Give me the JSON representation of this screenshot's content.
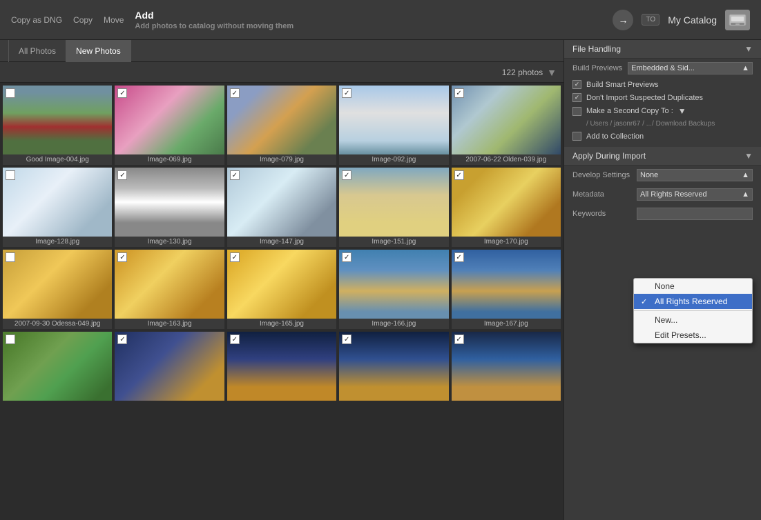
{
  "topbar": {
    "actions": [
      {
        "label": "Copy as DNG",
        "active": false
      },
      {
        "label": "Copy",
        "active": false
      },
      {
        "label": "Move",
        "active": false
      },
      {
        "label": "Add",
        "active": true
      }
    ],
    "subtitle": "Add photos to catalog without moving them",
    "arrow_symbol": "→",
    "to_badge": "TO",
    "catalog_name": "My Catalog",
    "drive_icon": "🖥"
  },
  "tabs": [
    {
      "label": "All Photos",
      "active": false
    },
    {
      "label": "New Photos",
      "active": true
    }
  ],
  "filter": {
    "photo_count": "122 photos",
    "filter_icon": "▼"
  },
  "photos": [
    {
      "id": "p1",
      "filename": "Good Image-004.jpg",
      "checked": false,
      "css_class": "img-red-barn"
    },
    {
      "id": "p2",
      "filename": "Image-069.jpg",
      "checked": true,
      "css_class": "img-tulips"
    },
    {
      "id": "p3",
      "filename": "Image-079.jpg",
      "checked": true,
      "css_class": "img-church"
    },
    {
      "id": "p4",
      "filename": "Image-092.jpg",
      "checked": true,
      "css_class": "img-cruise"
    },
    {
      "id": "p5",
      "filename": "2007-06-22 Olden-039.jpg",
      "checked": true,
      "css_class": "img-house"
    },
    {
      "id": "p6",
      "filename": "Image-128.jpg",
      "checked": false,
      "css_class": "img-ice1"
    },
    {
      "id": "p7",
      "filename": "Image-130.jpg",
      "checked": true,
      "css_class": "img-bw-wave"
    },
    {
      "id": "p8",
      "filename": "Image-147.jpg",
      "checked": true,
      "css_class": "img-ice2"
    },
    {
      "id": "p9",
      "filename": "Image-151.jpg",
      "checked": true,
      "css_class": "img-sand"
    },
    {
      "id": "p10",
      "filename": "Image-170.jpg",
      "checked": true,
      "css_class": "img-palace1"
    },
    {
      "id": "p11",
      "filename": "2007-09-30 Odessa-049.jpg",
      "checked": false,
      "css_class": "img-odessa"
    },
    {
      "id": "p12",
      "filename": "Image-163.jpg",
      "checked": true,
      "css_class": "img-opera"
    },
    {
      "id": "p13",
      "filename": "Image-165.jpg",
      "checked": true,
      "css_class": "img-palace2"
    },
    {
      "id": "p14",
      "filename": "Image-166.jpg",
      "checked": true,
      "css_class": "img-statue1"
    },
    {
      "id": "p15",
      "filename": "Image-167.jpg",
      "checked": true,
      "css_class": "img-statue2"
    },
    {
      "id": "p16",
      "filename": "",
      "checked": false,
      "css_class": "img-tram"
    },
    {
      "id": "p17",
      "filename": "",
      "checked": true,
      "css_class": "img-night1"
    },
    {
      "id": "p18",
      "filename": "",
      "checked": true,
      "css_class": "img-night2"
    },
    {
      "id": "p19",
      "filename": "",
      "checked": true,
      "css_class": "img-night3"
    },
    {
      "id": "p20",
      "filename": "",
      "checked": true,
      "css_class": "img-night4"
    }
  ],
  "right_panel": {
    "file_handling": {
      "header": "File Handling",
      "build_previews_label": "Build Previews",
      "build_previews_value": "Embedded & Sid...",
      "build_smart_previews_label": "Build Smart Previews",
      "build_smart_previews_checked": true,
      "dont_import_dupes_label": "Don't Import Suspected Duplicates",
      "dont_import_dupes_checked": true,
      "make_second_copy_label": "Make a Second Copy To :",
      "make_second_copy_checked": false,
      "second_copy_path": "/ Users / jasonr67 / .../ Download Backups",
      "add_to_collection_label": "Add to Collection",
      "add_to_collection_checked": false
    },
    "apply_during_import": {
      "header": "Apply During Import",
      "develop_settings_label": "Develop Settings",
      "develop_settings_value": "None",
      "metadata_label": "Metadata",
      "metadata_value": "All Rights Reserved",
      "keywords_label": "Keywords",
      "keywords_value": ""
    },
    "dropdown": {
      "visible": true,
      "items": [
        {
          "label": "None",
          "selected": false,
          "has_check": false
        },
        {
          "label": "All Rights Reserved",
          "selected": true,
          "has_check": true
        },
        {
          "label": "New...",
          "selected": false,
          "has_check": false,
          "divider_before": true
        },
        {
          "label": "Edit Presets...",
          "selected": false,
          "has_check": false
        }
      ]
    }
  }
}
